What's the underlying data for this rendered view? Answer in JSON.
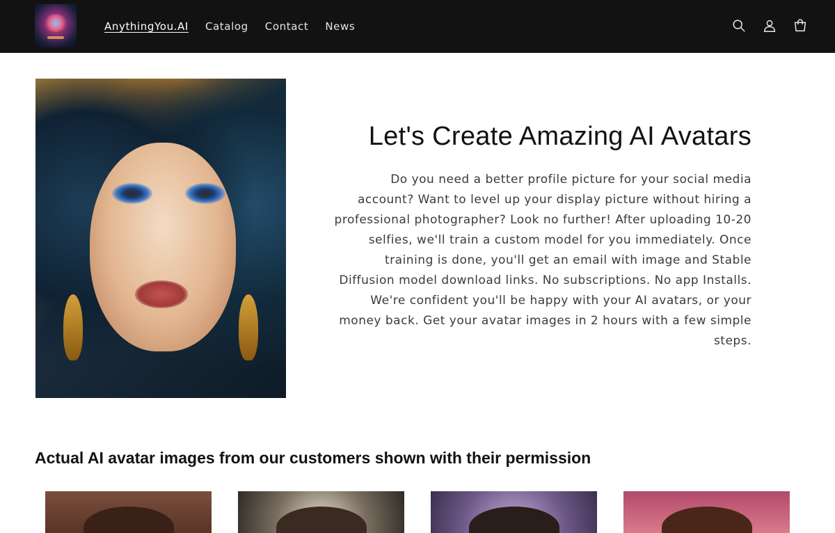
{
  "header": {
    "logo_alt": "AnythingYou.AI logo",
    "nav": [
      {
        "label": "AnythingYou.AI",
        "active": true
      },
      {
        "label": "Catalog",
        "active": false
      },
      {
        "label": "Contact",
        "active": false
      },
      {
        "label": "News",
        "active": false
      }
    ],
    "icons": [
      "search-icon",
      "account-icon",
      "cart-icon"
    ]
  },
  "hero": {
    "image_alt": "AI avatar portrait of a woman with blue eyeshadow and gold earrings",
    "title": "Let's Create Amazing AI Avatars",
    "text": "Do you need a better profile picture for your social media account? Want to level up your display picture without hiring a professional photographer? Look no further! After uploading 10-20 selfies, we'll train a custom model for you immediately. Once training is done, you'll get an email with image and Stable Diffusion model download links. No subscriptions. No app Installs. We're confident you'll be happy with your AI avatars, or your money back. Get your avatar images in 2 hours with a few simple steps."
  },
  "gallery": {
    "title": "Actual AI avatar images from our customers shown with their permission",
    "items": [
      {
        "alt": "Customer AI avatar 1"
      },
      {
        "alt": "Customer AI avatar 2"
      },
      {
        "alt": "Customer AI avatar 3"
      },
      {
        "alt": "Customer AI avatar 4"
      }
    ]
  },
  "colors": {
    "header_bg": "#121212",
    "nav_text": "#e6e6e6",
    "body_text": "#3b3b3b"
  }
}
